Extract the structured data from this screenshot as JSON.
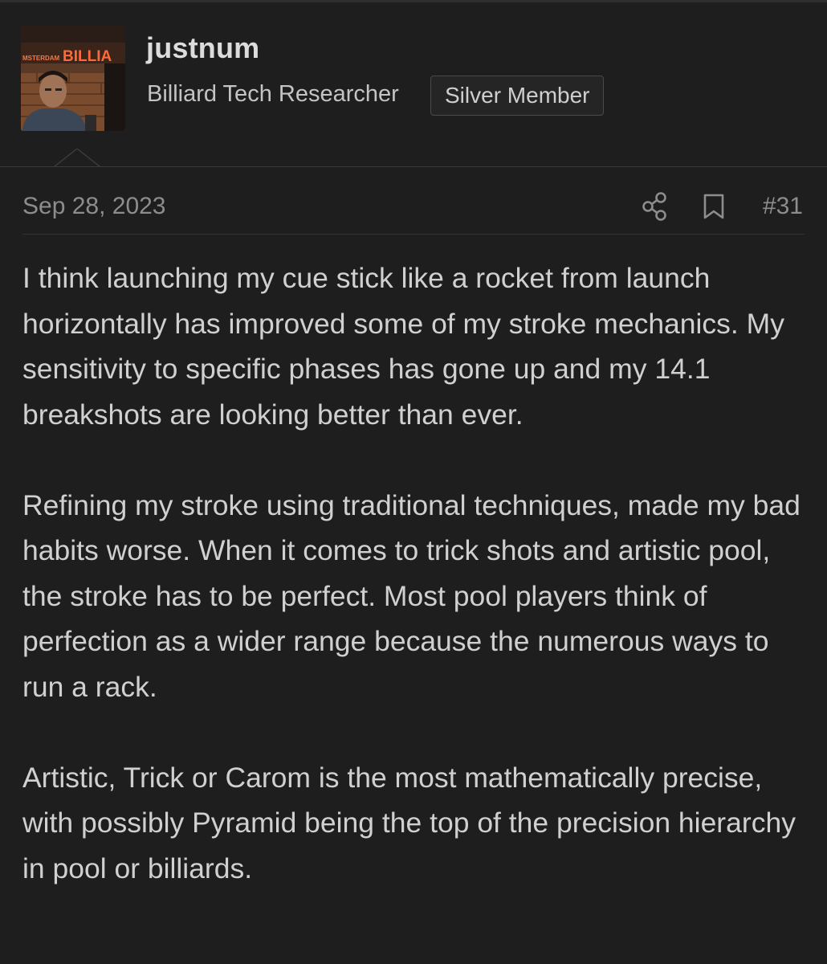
{
  "author": {
    "username": "justnum",
    "title": "Billiard Tech Researcher",
    "badge": "Silver Member",
    "avatar_sign_text": "MSTERDAM BILLIA"
  },
  "post": {
    "date": "Sep 28, 2023",
    "number": "#31",
    "actions": {
      "share_icon": "share-icon",
      "bookmark_icon": "bookmark-icon"
    },
    "paragraphs": [
      "I think launching my cue stick like a rocket from launch horizontally has improved some of my stroke mechanics. My sensitivity to specific phases has gone up and my 14.1 breakshots are looking better than ever.",
      "Refining my stroke using traditional techniques, made my bad habits worse. When it comes to trick shots and artistic pool, the stroke has to be perfect. Most pool players think of perfection as a wider range because the numerous ways to run a rack.",
      "Artistic, Trick or Carom is the most mathematically precise, with possibly Pyramid being the top of the precision hierarchy in pool or billiards."
    ]
  },
  "colors": {
    "background": "#1e1e1f",
    "text": "#d0d0d0",
    "muted": "#8d8d8d",
    "badge_border": "#4a4a4b"
  }
}
